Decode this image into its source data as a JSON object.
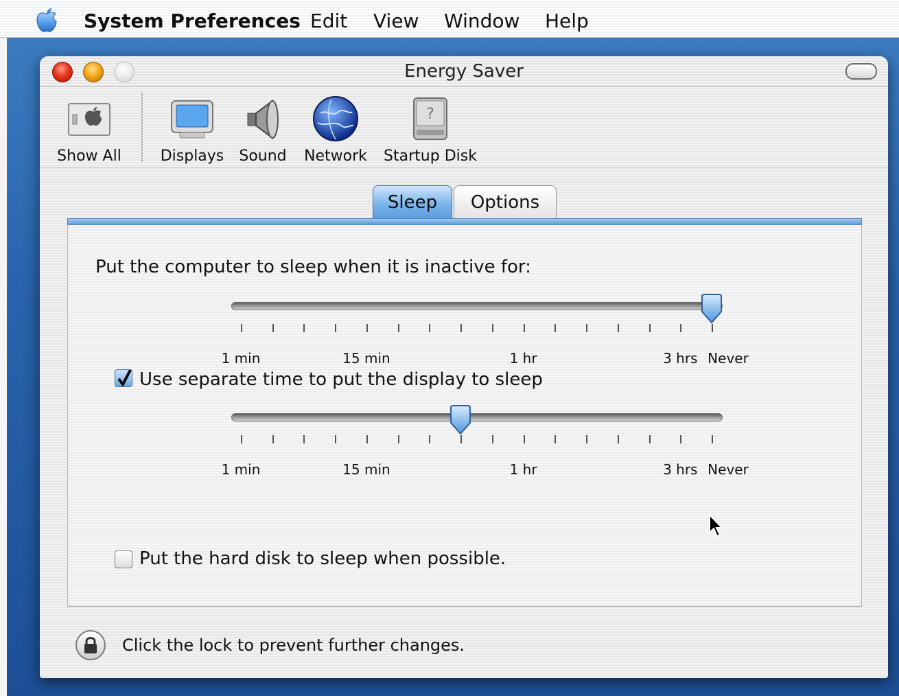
{
  "menubar": {
    "app_name": "System Preferences",
    "items": [
      "Edit",
      "View",
      "Window",
      "Help"
    ]
  },
  "window": {
    "title": "Energy Saver"
  },
  "toolbar": {
    "items": [
      {
        "label": "Show All",
        "icon": "show-all-icon"
      },
      {
        "label": "Displays",
        "icon": "displays-icon"
      },
      {
        "label": "Sound",
        "icon": "sound-icon"
      },
      {
        "label": "Network",
        "icon": "network-icon"
      },
      {
        "label": "Startup Disk",
        "icon": "startup-disk-icon"
      }
    ]
  },
  "tabs": [
    {
      "label": "Sleep",
      "selected": true
    },
    {
      "label": "Options",
      "selected": false
    }
  ],
  "sleep": {
    "computer_prompt": "Put the computer to sleep when it is inactive for:",
    "computer_slider": {
      "value": "Never",
      "position_fraction": 1.0
    },
    "display_checkbox_label": "Use separate time to put the display to sleep",
    "display_checkbox_checked": true,
    "display_slider": {
      "position_fraction": 0.467
    },
    "tick_labels": [
      "1 min",
      "15 min",
      "1 hr",
      "3 hrs",
      "Never"
    ],
    "disk_checkbox_label": "Put the hard disk to sleep when possible.",
    "disk_checkbox_checked": false
  },
  "lock": {
    "text": "Click the lock to prevent further changes."
  },
  "colors": {
    "accent": "#5a9bdc",
    "close": "#e8341c",
    "minimize": "#f2a618",
    "desktop": "#2a64ad"
  }
}
